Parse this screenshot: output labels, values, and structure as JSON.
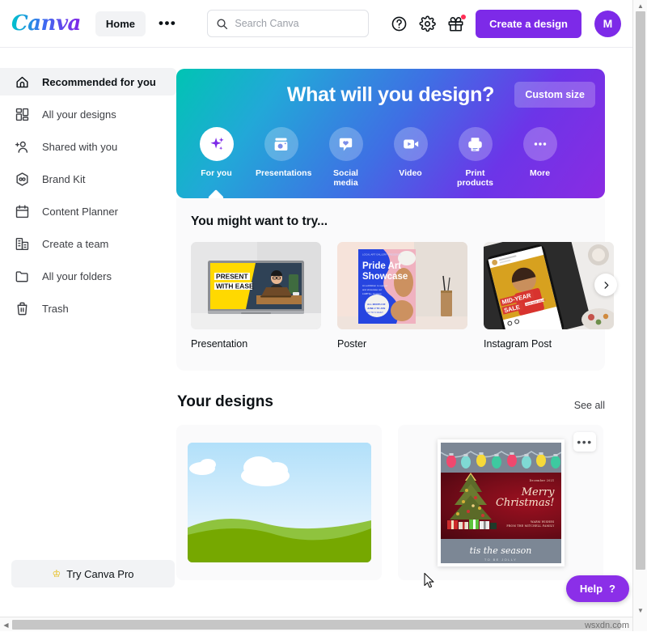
{
  "topnav": {
    "logo_text": "Canva",
    "home_label": "Home",
    "more_dots": "•••",
    "search": {
      "placeholder": "Search Canva",
      "value": ""
    },
    "icons": [
      "help-circle-icon",
      "gear-icon",
      "gift-icon"
    ],
    "create_label": "Create a design",
    "avatar_initial": "M"
  },
  "sidebar": {
    "items": [
      {
        "label": "Recommended for you",
        "icon": "home-icon",
        "active": true
      },
      {
        "label": "All your designs",
        "icon": "grid-icon",
        "active": false
      },
      {
        "label": "Shared with you",
        "icon": "add-people-icon",
        "active": false
      },
      {
        "label": "Brand Kit",
        "icon": "brand-hexagon-icon",
        "active": false
      },
      {
        "label": "Content Planner",
        "icon": "calendar-icon",
        "active": false
      },
      {
        "label": "Create a team",
        "icon": "building-icon",
        "active": false
      },
      {
        "label": "All your folders",
        "icon": "folder-icon",
        "active": false
      },
      {
        "label": "Trash",
        "icon": "trash-icon",
        "active": false
      }
    ],
    "pro_button": {
      "label": "Try Canva Pro",
      "icon": "crown-icon",
      "crown_glyph": "♔"
    }
  },
  "hero": {
    "title": "What will you design?",
    "custom_size_label": "Custom size",
    "gradient_from": "#00c4b3",
    "gradient_to": "#8a2be2",
    "categories": [
      {
        "label": "For you",
        "icon": "sparkle-icon",
        "selected": true
      },
      {
        "label": "Presentations",
        "icon": "projector-icon",
        "selected": false
      },
      {
        "label": "Social media",
        "icon": "heart-speech-bubble-icon",
        "selected": false
      },
      {
        "label": "Video",
        "icon": "video-camera-icon",
        "selected": false
      },
      {
        "label": "Print products",
        "icon": "printer-icon",
        "selected": false
      },
      {
        "label": "More",
        "icon": "ellipsis-icon",
        "selected": false
      }
    ]
  },
  "try_section": {
    "title": "You might want to try...",
    "next_arrow_icon": "chevron-right-icon",
    "cards": [
      {
        "label": "Presentation",
        "thumb": "presentation-laptop-thumb",
        "headline_line1": "PRESENT",
        "headline_line2": "WITH EASE"
      },
      {
        "label": "Poster",
        "thumb": "poster-pride-art-thumb",
        "headline_line1": "Pride Art",
        "headline_line2": "Showcase"
      },
      {
        "label": "Instagram Post",
        "thumb": "instagram-phone-thumb",
        "headline_line1": "MID-YEAR",
        "headline_line2": "SALE"
      }
    ]
  },
  "your_designs": {
    "title": "Your designs",
    "see_all_label": "See all",
    "cards": [
      {
        "name": "landscape-hills-design",
        "more_icon": "ellipsis-icon",
        "has_more": false
      },
      {
        "name": "merry-christmas-card-design",
        "more_icon": "ellipsis-icon",
        "has_more": true,
        "date": "December 2021",
        "greeting_line1": "Merry",
        "greeting_line2": "Christmas!",
        "wishes_line1": "WARM WISHES",
        "wishes_line2": "FROM THE MITCHELL FAMILY",
        "footer_line1": "tis the season",
        "footer_line2": "TO BE JOLLY"
      }
    ]
  },
  "help_widget": {
    "label": "Help",
    "glyph": "?",
    "color": "#8b2fe8"
  },
  "watermark": {
    "text": "wsxdn.com"
  },
  "scrollbars": {
    "vertical": {
      "up_glyph": "▲",
      "down_glyph": "▼"
    },
    "horizontal": {
      "left_glyph": "◀"
    }
  }
}
